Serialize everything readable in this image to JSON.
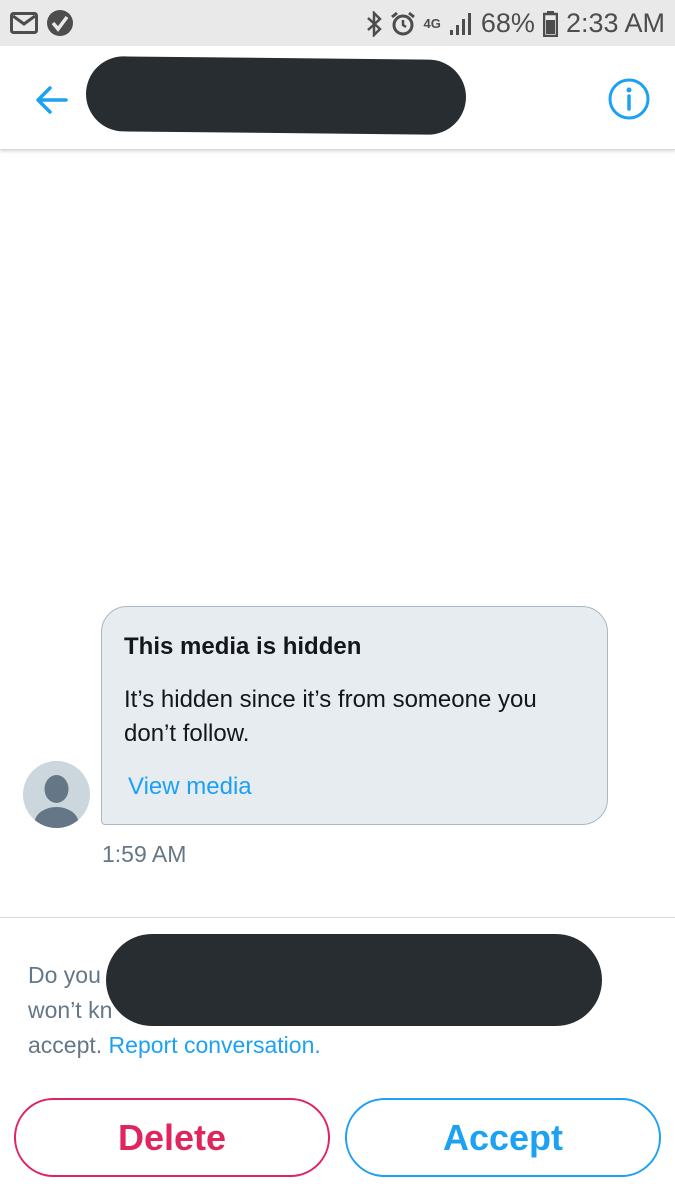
{
  "status_bar": {
    "network": "4G",
    "battery": "68%",
    "time": "2:33 AM"
  },
  "header": {
    "back_icon": "arrow-left-icon",
    "info_icon": "info-icon",
    "accent": "#1da1f2"
  },
  "message": {
    "title": "This media is hidden",
    "body": "It’s hidden since it’s from someone you don’t follow.",
    "link": "View media",
    "time": "1:59 AM"
  },
  "request": {
    "line1": "Do you",
    "line2": "won’t kn",
    "line3_prefix": "accept.",
    "report_link": "Report conversation."
  },
  "buttons": {
    "delete": "Delete",
    "accept": "Accept",
    "delete_color": "#e0245e",
    "accept_color": "#1da1f2"
  }
}
